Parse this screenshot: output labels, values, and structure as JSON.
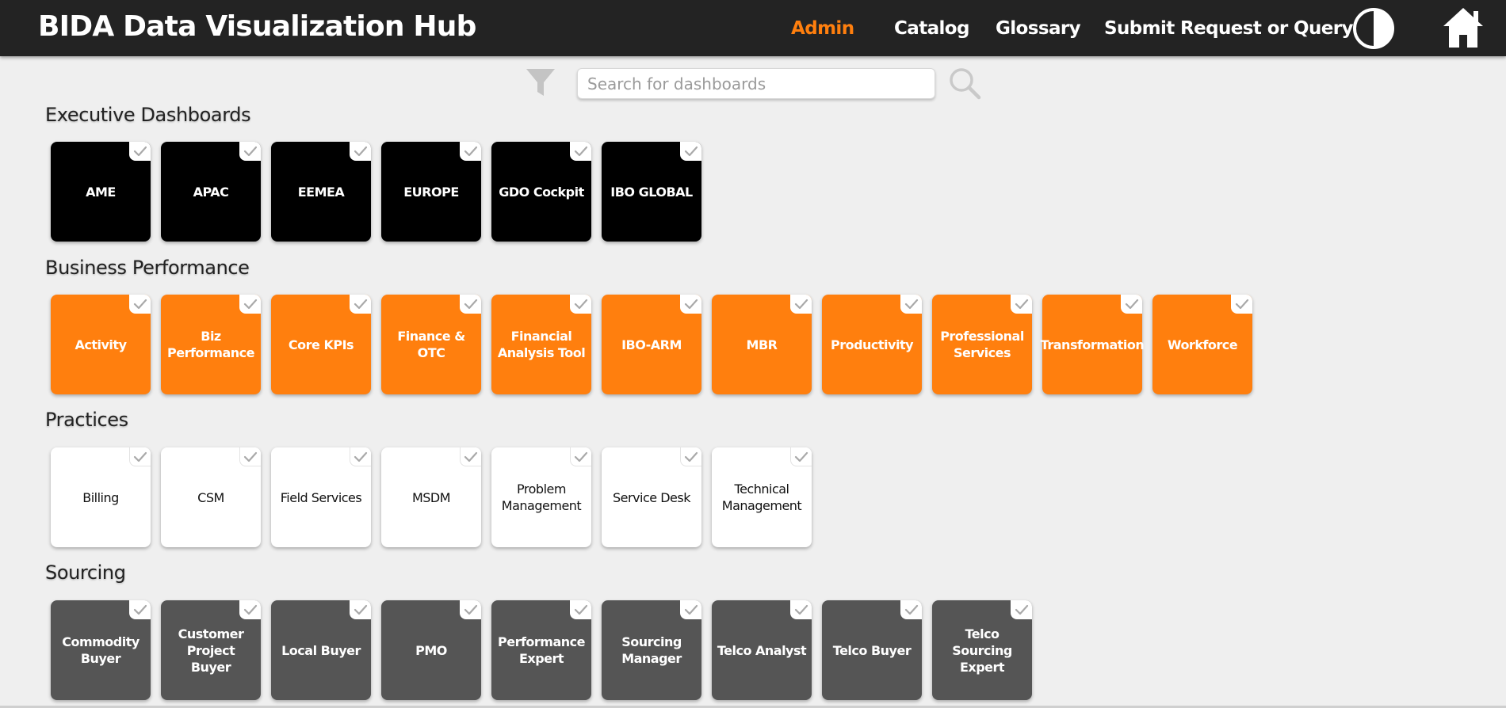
{
  "header": {
    "title": "BIDA Data Visualization Hub",
    "nav": [
      {
        "label": "Admin",
        "active": true
      },
      {
        "label": "Catalog",
        "active": false
      },
      {
        "label": "Glossary",
        "active": false
      },
      {
        "label": "Submit Request or Query",
        "active": false
      }
    ],
    "icons": [
      "contrast-toggle-icon",
      "home-icon"
    ]
  },
  "search": {
    "placeholder": "Search for dashboards",
    "value": "",
    "icons": [
      "filter-icon",
      "search-icon"
    ]
  },
  "colors": {
    "accent": "#ff7f0e",
    "header_bg": "#232323",
    "page_bg": "#efefef",
    "exec_tile": "#000000",
    "biz_tile": "#ff7f0e",
    "practice_tile": "#ffffff",
    "sourcing_tile": "#555555"
  },
  "sections": [
    {
      "title": "Executive Dashboards",
      "style": "exec",
      "tiles": [
        "AME",
        "APAC",
        "EEMEA",
        "EUROPE",
        "GDO Cockpit",
        "IBO GLOBAL"
      ]
    },
    {
      "title": "Business Performance",
      "style": "biz",
      "tiles": [
        "Activity",
        "Biz Performance",
        "Core KPIs",
        "Finance & OTC",
        "Financial Analysis Tool",
        "IBO-ARM",
        "MBR",
        "Productivity",
        "Professional Services",
        "Transformation",
        "Workforce"
      ]
    },
    {
      "title": "Practices",
      "style": "prac",
      "tiles": [
        "Billing",
        "CSM",
        "Field Services",
        "MSDM",
        "Problem Management",
        "Service Desk",
        "Technical Management"
      ]
    },
    {
      "title": "Sourcing",
      "style": "src",
      "tiles": [
        "Commodity Buyer",
        "Customer Project Buyer",
        "Local Buyer",
        "PMO",
        "Performance Expert",
        "Sourcing Manager",
        "Telco Analyst",
        "Telco Buyer",
        "Telco Sourcing Expert"
      ]
    }
  ]
}
